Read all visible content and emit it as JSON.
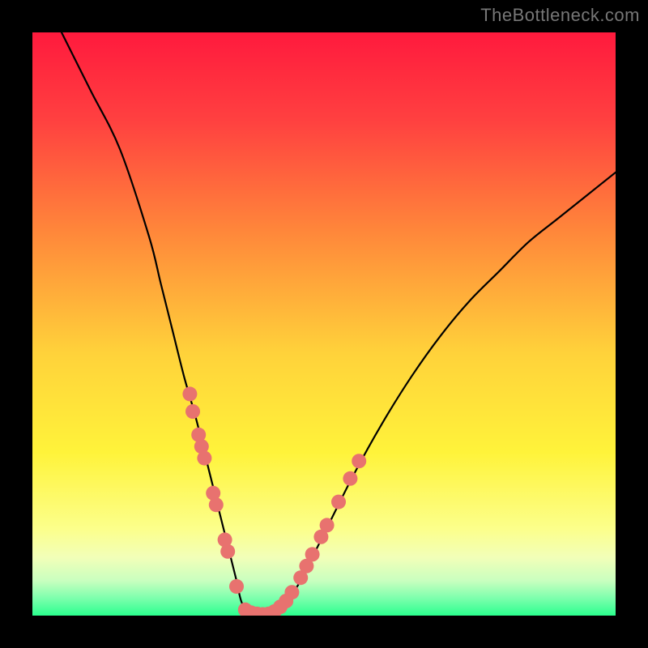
{
  "watermark": "TheBottleneck.com",
  "chart_data": {
    "type": "line",
    "title": "",
    "xlabel": "",
    "ylabel": "",
    "xlim": [
      0,
      100
    ],
    "ylim": [
      0,
      100
    ],
    "series": [
      {
        "name": "curve",
        "x": [
          5,
          10,
          15,
          20,
          22,
          24,
          26,
          28,
          30,
          32,
          33,
          34,
          35,
          36,
          38,
          40,
          42,
          44,
          46,
          48,
          50,
          55,
          60,
          65,
          70,
          75,
          80,
          85,
          90,
          95,
          100
        ],
        "y": [
          100,
          90,
          80,
          65,
          57,
          49,
          41,
          34,
          26,
          18,
          14,
          10,
          6,
          2,
          0,
          0,
          1,
          3,
          6,
          10,
          14,
          24,
          33,
          41,
          48,
          54,
          59,
          64,
          68,
          72,
          76
        ]
      }
    ],
    "markers": {
      "name": "dots",
      "color": "#e8726f",
      "points": [
        {
          "x": 27.0,
          "y": 38
        },
        {
          "x": 27.5,
          "y": 35
        },
        {
          "x": 28.5,
          "y": 31
        },
        {
          "x": 29.0,
          "y": 29
        },
        {
          "x": 29.5,
          "y": 27
        },
        {
          "x": 31.0,
          "y": 21
        },
        {
          "x": 31.5,
          "y": 19
        },
        {
          "x": 33.0,
          "y": 13
        },
        {
          "x": 33.5,
          "y": 11
        },
        {
          "x": 35.0,
          "y": 5
        },
        {
          "x": 36.5,
          "y": 1
        },
        {
          "x": 37.5,
          "y": 0.5
        },
        {
          "x": 38.5,
          "y": 0.3
        },
        {
          "x": 39.5,
          "y": 0.2
        },
        {
          "x": 40.5,
          "y": 0.3
        },
        {
          "x": 41.5,
          "y": 0.7
        },
        {
          "x": 42.5,
          "y": 1.5
        },
        {
          "x": 43.5,
          "y": 2.5
        },
        {
          "x": 44.5,
          "y": 4
        },
        {
          "x": 46.0,
          "y": 6.5
        },
        {
          "x": 47.0,
          "y": 8.5
        },
        {
          "x": 48.0,
          "y": 10.5
        },
        {
          "x": 49.5,
          "y": 13.5
        },
        {
          "x": 50.5,
          "y": 15.5
        },
        {
          "x": 52.5,
          "y": 19.5
        },
        {
          "x": 54.5,
          "y": 23.5
        },
        {
          "x": 56.0,
          "y": 26.5
        }
      ]
    },
    "gradient_stops": [
      {
        "offset": 0.0,
        "color": "#ff1a3d"
      },
      {
        "offset": 0.15,
        "color": "#ff4040"
      },
      {
        "offset": 0.35,
        "color": "#ff8a3a"
      },
      {
        "offset": 0.55,
        "color": "#ffd23a"
      },
      {
        "offset": 0.72,
        "color": "#fff33a"
      },
      {
        "offset": 0.85,
        "color": "#fcff8a"
      },
      {
        "offset": 0.9,
        "color": "#f2ffb8"
      },
      {
        "offset": 0.94,
        "color": "#c9ffbf"
      },
      {
        "offset": 0.97,
        "color": "#7dffad"
      },
      {
        "offset": 1.0,
        "color": "#2bff8e"
      }
    ]
  }
}
